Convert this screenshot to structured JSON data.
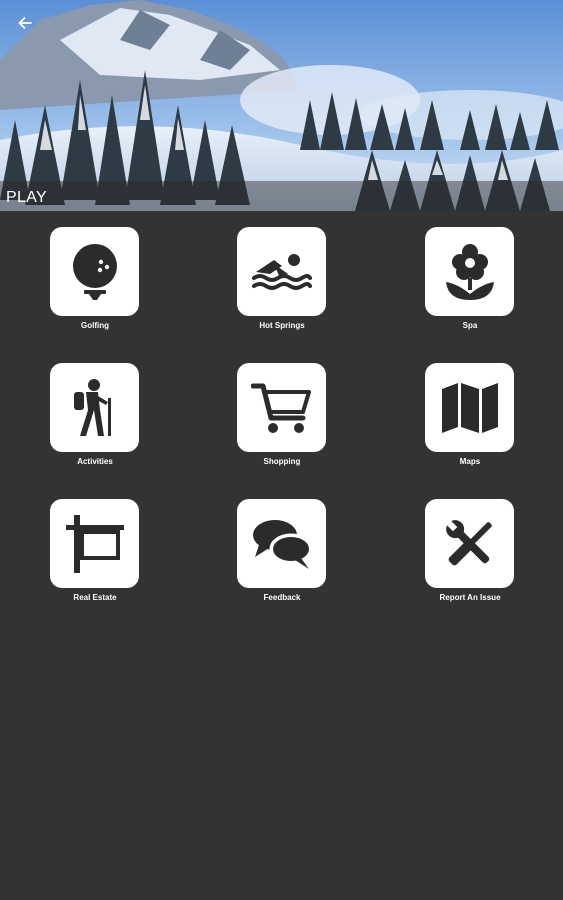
{
  "header": {
    "title": "PLAY",
    "back_icon": "arrow-left-icon"
  },
  "tiles": [
    {
      "label": "Golfing",
      "icon": "golf-ball-icon"
    },
    {
      "label": "Hot Springs",
      "icon": "swimmer-icon"
    },
    {
      "label": "Spa",
      "icon": "flower-icon"
    },
    {
      "label": "Activities",
      "icon": "hiker-icon"
    },
    {
      "label": "Shopping",
      "icon": "shopping-cart-icon"
    },
    {
      "label": "Maps",
      "icon": "map-icon"
    },
    {
      "label": "Real Estate",
      "icon": "sign-post-icon"
    },
    {
      "label": "Feedback",
      "icon": "chat-bubbles-icon"
    },
    {
      "label": "Report An Issue",
      "icon": "tools-icon"
    }
  ],
  "colors": {
    "background": "#333333",
    "tile": "#ffffff",
    "icon": "#2b2b2b"
  }
}
